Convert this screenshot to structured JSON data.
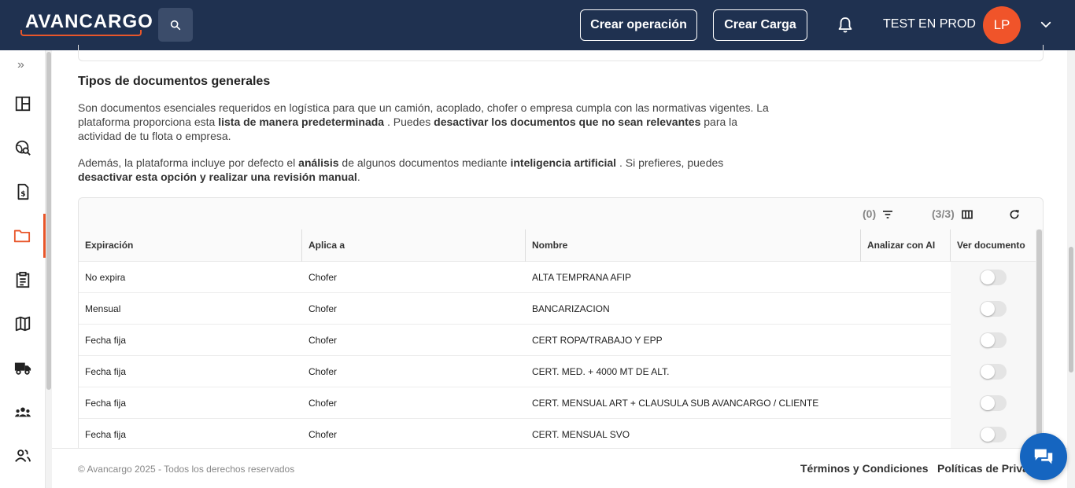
{
  "header": {
    "logo_text": "AVANCARGO",
    "btn_operacion": "Crear operación",
    "btn_carga": "Crear Carga",
    "user_name": "TEST EN PROD",
    "avatar_initials": "LP"
  },
  "sidebar": {
    "expand_label": "»",
    "items": [
      "dashboard-icon",
      "globe-search-icon",
      "invoice-icon",
      "folder-icon",
      "clipboard-icon",
      "map-icon",
      "truck-icon",
      "group-icon",
      "people-icon"
    ]
  },
  "content": {
    "title": "Tipos de documentos generales",
    "p1_a": "Son documentos esenciales requeridos en logística para que un camión, acoplado, chofer o empresa cumpla con las normativas vigentes. La plataforma proporciona esta ",
    "p1_b": "lista de manera predeterminada",
    "p1_c": " . Puedes ",
    "p1_d": "desactivar los documentos que no sean relevantes",
    "p1_e": " para la actividad de tu flota o empresa.",
    "p2_a": "Además, la plataforma incluye por defecto el ",
    "p2_b": "análisis",
    "p2_c": " de algunos documentos mediante ",
    "p2_d": "inteligencia artificial",
    "p2_e": " . Si prefieres, puedes ",
    "p2_f": "desactivar esta opción y realizar una revisión manual",
    "p2_g": "."
  },
  "table": {
    "filter_count": "(0)",
    "columns_count": "(3/3)",
    "headers": [
      "Expiración",
      "Aplica a",
      "Nombre",
      "Analizar con AI",
      "Ver documento"
    ],
    "rows": [
      {
        "exp": "No expira",
        "aplica": "Chofer",
        "nombre": "ALTA TEMPRANA AFIP"
      },
      {
        "exp": "Mensual",
        "aplica": "Chofer",
        "nombre": "BANCARIZACION"
      },
      {
        "exp": "Fecha fija",
        "aplica": "Chofer",
        "nombre": "CERT ROPA/TRABAJO Y EPP"
      },
      {
        "exp": "Fecha fija",
        "aplica": "Chofer",
        "nombre": "CERT. MED. + 4000 MT DE ALT."
      },
      {
        "exp": "Fecha fija",
        "aplica": "Chofer",
        "nombre": "CERT. MENSUAL ART + CLAUSULA SUB AVANCARGO / CLIENTE"
      },
      {
        "exp": "Fecha fija",
        "aplica": "Chofer",
        "nombre": "CERT. MENSUAL SVO"
      }
    ]
  },
  "footer": {
    "copyright": "© Avancargo 2025 - Todos los derechos reservados",
    "terms": "Términos y Condiciones",
    "privacy": "Políticas de Priva"
  },
  "colors": {
    "header_bg": "#1f3150",
    "accent": "#e8562a",
    "chat": "#1565c0"
  }
}
